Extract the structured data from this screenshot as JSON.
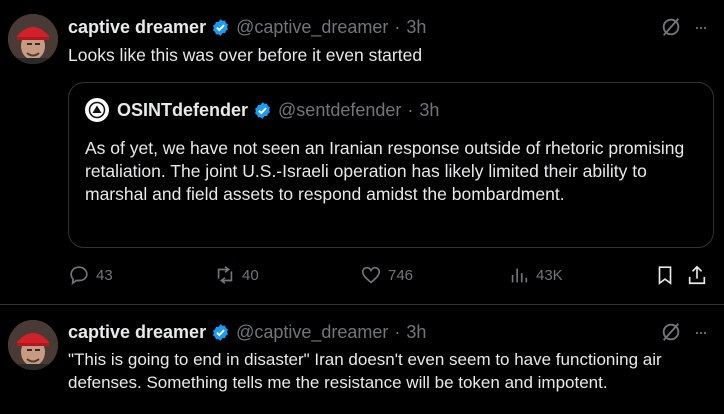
{
  "tweet1": {
    "name": "captive dreamer",
    "handle": "@captive_dreamer",
    "separator": "·",
    "time": "3h",
    "text": "Looks like this was over before it even started",
    "quote": {
      "name": "OSINTdefender",
      "handle": "@sentdefender",
      "separator": "·",
      "time": "3h",
      "text": "As of yet, we have not seen an Iranian response outside of rhetoric promising retaliation. The joint U.S.-Israeli operation has likely limited their ability to marshal and field assets to respond amidst the bombardment."
    },
    "actions": {
      "replies": "43",
      "reposts": "40",
      "likes": "746",
      "views": "43K"
    },
    "more_label": "···"
  },
  "tweet2": {
    "name": "captive dreamer",
    "handle": "@captive_dreamer",
    "separator": "·",
    "time": "3h",
    "text": "\"This is going to end in disaster\" Iran doesn't even seem to have functioning air defenses.  Something tells me the resistance will be token and impotent.",
    "more_label": "···"
  },
  "colors": {
    "background": "#000000",
    "text": "#e7e9ea",
    "muted": "#71767b",
    "verified": "#1d9bf0",
    "border": "#2f3336"
  },
  "icons": [
    "verified-badge-icon",
    "grok-icon",
    "more-icon",
    "reply-icon",
    "repost-icon",
    "like-icon",
    "views-icon",
    "bookmark-icon",
    "share-icon"
  ]
}
